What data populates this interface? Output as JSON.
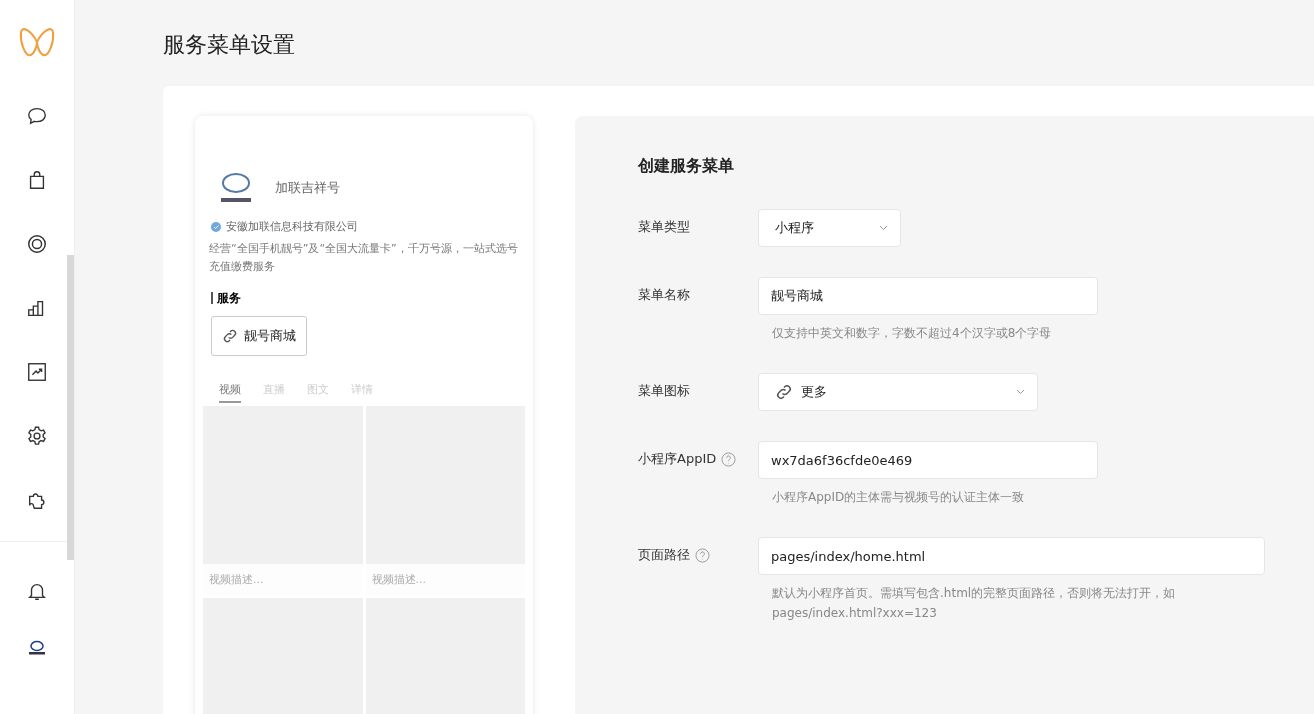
{
  "page_title": "服务菜单设置",
  "preview": {
    "account_name": "加联吉祥号",
    "company": "安徽加联信息科技有限公司",
    "description": "经营“全国手机靓号”及“全国大流量卡”，千万号源，一站式选号充值缴费服务",
    "section_title": "服务",
    "service_button": "靓号商城",
    "tabs": [
      {
        "label": "视频",
        "selected": true
      },
      {
        "label": "直播",
        "selected": false
      },
      {
        "label": "图文",
        "selected": false
      },
      {
        "label": "详情",
        "selected": false
      }
    ],
    "videos": [
      {
        "kind": "card",
        "caption": "视频描述..."
      },
      {
        "kind": "card",
        "caption": "视频描述..."
      },
      {
        "kind": "card"
      },
      {
        "kind": "card"
      }
    ]
  },
  "form": {
    "title": "创建服务菜单",
    "fields": [
      {
        "kind": "select",
        "label": "菜单类型",
        "value": "小程序"
      },
      {
        "kind": "input",
        "label": "菜单名称",
        "value": "靓号商城",
        "hint": "仅支持中英文和数字，字数不超过4个汉字或8个字母"
      },
      {
        "kind": "icon-select",
        "label": "菜单图标",
        "value": "更多"
      },
      {
        "kind": "input",
        "label": "小程序AppID",
        "help": true,
        "value": "wx7da6f36cfde0e469",
        "hint": "小程序AppID的主体需与视频号的认证主体一致"
      },
      {
        "kind": "input",
        "label": "页面路径",
        "help": true,
        "value": "pages/index/home.html",
        "hint": "默认为小程序首页。需填写包含.html的完整页面路径，否则将无法打开，如pages/index.html?xxx=123"
      }
    ]
  }
}
